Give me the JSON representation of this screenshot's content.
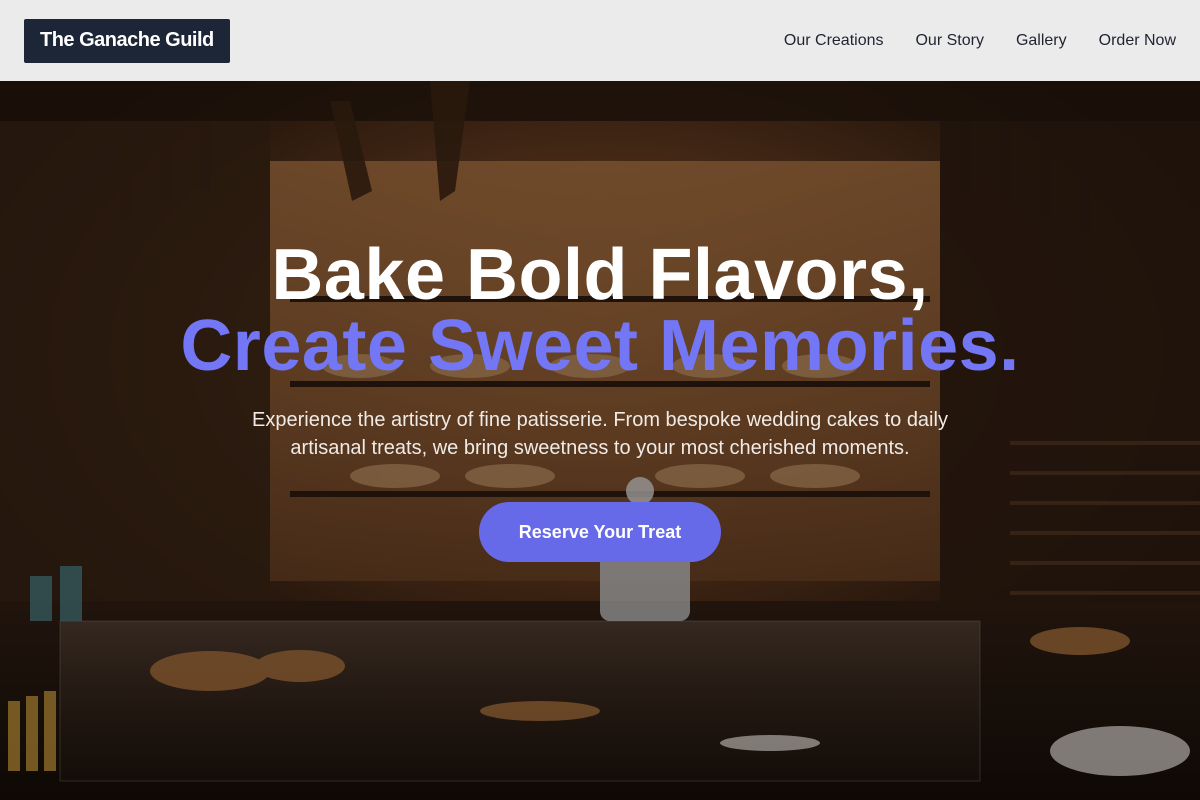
{
  "header": {
    "logo": "The Ganache Guild",
    "nav": [
      {
        "label": "Our Creations"
      },
      {
        "label": "Our Story"
      },
      {
        "label": "Gallery"
      },
      {
        "label": "Order Now"
      }
    ]
  },
  "hero": {
    "headline_line1": "Bake Bold Flavors,",
    "headline_line2": "Create Sweet Memories.",
    "description": "Experience the artistry of fine patisserie. From bespoke wedding cakes to daily artisanal treats, we bring sweetness to your most cherished moments.",
    "cta_label": "Reserve Your Treat",
    "background_image": "bakery-interior-photo"
  },
  "colors": {
    "accent": "#676ae8",
    "headline_accent": "#7377f5",
    "logo_bg": "#1d2636",
    "header_bg": "#ebebeb"
  }
}
